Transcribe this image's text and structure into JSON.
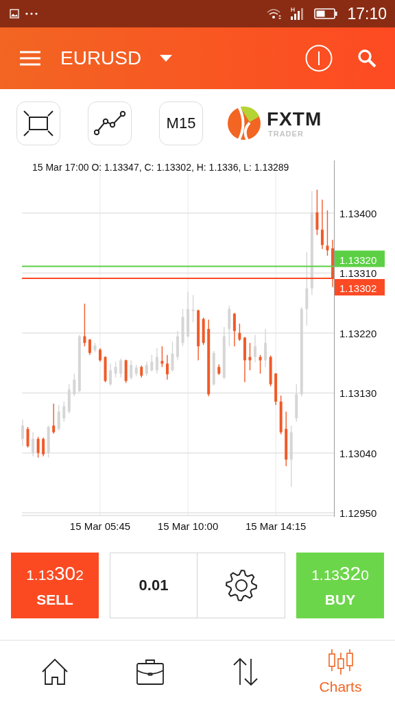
{
  "status_bar": {
    "time": "17:10"
  },
  "header": {
    "symbol": "EURUSD"
  },
  "toolbar": {
    "timeframe": "M15",
    "logo": {
      "name": "FXTM",
      "sub": "TRADER"
    }
  },
  "chart": {
    "caption": "15 Mar 17:00 O: 1.13347, C: 1.13302, H: 1.1336, L: 1.13289",
    "chart_data": {
      "type": "candlestick",
      "grid": true,
      "ref_lines": [
        {
          "axis": "y",
          "value": 1.1332,
          "color": "#5cd045",
          "label": "1.13320"
        },
        {
          "axis": "y",
          "value": 1.13302,
          "color": "#fb4a24",
          "label": "1.13302"
        }
      ],
      "categories": [
        null,
        null,
        null,
        null,
        null,
        null,
        null,
        null,
        null,
        null,
        null,
        null,
        null,
        null,
        null,
        "15 Mar 05:45",
        null,
        null,
        null,
        null,
        null,
        null,
        null,
        null,
        null,
        null,
        null,
        null,
        null,
        null,
        null,
        null,
        "15 Mar 10:00",
        null,
        null,
        null,
        null,
        null,
        null,
        null,
        null,
        null,
        null,
        null,
        null,
        null,
        null,
        null,
        null,
        "15 Mar 14:15",
        null,
        null,
        null,
        null,
        null,
        null,
        null,
        null,
        null,
        null,
        null
      ],
      "ohlc": [
        [
          1.13061,
          1.1309,
          1.1305,
          1.13081
        ],
        [
          1.13076,
          1.13079,
          1.13048,
          1.1305
        ],
        [
          1.1304,
          1.13071,
          1.13035,
          1.13061
        ],
        [
          1.13061,
          1.13064,
          1.13033,
          1.1304
        ],
        [
          1.13061,
          1.13063,
          1.13035,
          1.13038
        ],
        [
          1.1304,
          1.13081,
          1.13033,
          1.13079
        ],
        [
          1.13081,
          1.13114,
          1.13069,
          1.13071
        ],
        [
          1.13076,
          1.13112,
          1.13073,
          1.13102
        ],
        [
          1.13092,
          1.13117,
          1.13087,
          1.1311
        ],
        [
          1.13102,
          1.13143,
          1.13099,
          1.13135
        ],
        [
          1.13128,
          1.13159,
          1.13125,
          1.1315
        ],
        [
          1.13133,
          1.13217,
          1.13131,
          1.13215
        ],
        [
          1.13215,
          1.13264,
          1.132,
          1.13205
        ],
        [
          1.1321,
          1.13211,
          1.13187,
          1.1319
        ],
        [
          1.13194,
          1.13205,
          1.13191,
          1.13201
        ],
        [
          1.13195,
          1.13197,
          1.13177,
          1.13179
        ],
        [
          1.13184,
          1.13185,
          1.13146,
          1.13148
        ],
        [
          1.13143,
          1.13174,
          1.13141,
          1.13164
        ],
        [
          1.13159,
          1.13177,
          1.13153,
          1.13169
        ],
        [
          1.13159,
          1.13182,
          1.13153,
          1.13179
        ],
        [
          1.13179,
          1.1318,
          1.13145,
          1.13148
        ],
        [
          1.13153,
          1.13179,
          1.1315,
          1.13172
        ],
        [
          1.13159,
          1.13172,
          1.13155,
          1.13168
        ],
        [
          1.13169,
          1.13171,
          1.13153,
          1.13156
        ],
        [
          1.13159,
          1.13177,
          1.13155,
          1.13172
        ],
        [
          1.13164,
          1.13187,
          1.13162,
          1.13177
        ],
        [
          1.13164,
          1.13197,
          1.13159,
          1.13184
        ],
        [
          1.13178,
          1.132,
          1.13169,
          1.13174
        ],
        [
          1.13174,
          1.13187,
          1.1315,
          1.13158
        ],
        [
          1.13164,
          1.13207,
          1.13162,
          1.13189
        ],
        [
          1.13184,
          1.13223,
          1.13179,
          1.13215
        ],
        [
          1.13205,
          1.13256,
          1.132,
          1.13244
        ],
        [
          1.13215,
          1.13282,
          1.13213,
          1.13256
        ],
        [
          1.13253,
          1.13277,
          1.13236,
          1.13255
        ],
        [
          1.13254,
          1.13255,
          1.13179,
          1.132
        ],
        [
          1.13241,
          1.13243,
          1.13202,
          1.13205
        ],
        [
          1.13226,
          1.1324,
          1.13125,
          1.13128
        ],
        [
          1.13143,
          1.13193,
          1.13141,
          1.1319
        ],
        [
          1.13169,
          1.13173,
          1.13157,
          1.13159
        ],
        [
          1.13153,
          1.13229,
          1.13151,
          1.13215
        ],
        [
          1.13226,
          1.13261,
          1.132,
          1.13256
        ],
        [
          1.13249,
          1.1325,
          1.132,
          1.13223
        ],
        [
          1.1322,
          1.13234,
          1.13208,
          1.1321
        ],
        [
          1.13213,
          1.13214,
          1.13146,
          1.13179
        ],
        [
          1.13184,
          1.13205,
          1.13164,
          1.13179
        ],
        [
          1.13184,
          1.13217,
          1.13176,
          1.132
        ],
        [
          1.13184,
          1.13187,
          1.13159,
          1.13179
        ],
        [
          1.13179,
          1.13226,
          1.13169,
          1.13205
        ],
        [
          1.13184,
          1.13186,
          1.1314,
          1.13143
        ],
        [
          1.13159,
          1.1316,
          1.13112,
          1.13117
        ],
        [
          1.13117,
          1.13126,
          1.13068,
          1.13071
        ],
        [
          1.13076,
          1.13102,
          1.1302,
          1.1303
        ],
        [
          1.1303,
          1.13081,
          1.12989,
          1.13071
        ],
        [
          1.13092,
          1.13143,
          1.13087,
          1.13128
        ],
        [
          1.13128,
          1.13259,
          1.13125,
          1.13256
        ],
        [
          1.13256,
          1.13341,
          1.13231,
          1.13287
        ],
        [
          1.13287,
          1.13433,
          1.13277,
          1.13401
        ],
        [
          1.13401,
          1.13435,
          1.13367,
          1.13375
        ],
        [
          1.13375,
          1.1342,
          1.13346,
          1.13352
        ],
        [
          1.13351,
          1.13404,
          1.13336,
          1.13344
        ],
        [
          1.13347,
          1.1336,
          1.13289,
          1.13302
        ]
      ],
      "ylim": [
        1.12946,
        1.1348
      ],
      "yticks": [
        {
          "value": 1.134,
          "label": "1.13400"
        },
        {
          "value": 1.1331,
          "label": "1.13310"
        },
        {
          "value": 1.1322,
          "label": "1.13220"
        },
        {
          "value": 1.1313,
          "label": "1.13130"
        },
        {
          "value": 1.1304,
          "label": "1.13040"
        },
        {
          "value": 1.1295,
          "label": "1.12950"
        }
      ]
    }
  },
  "trade": {
    "sell": {
      "big": "1.13",
      "pips": "30",
      "last": "2",
      "label": "SELL"
    },
    "lot": "0.01",
    "buy": {
      "big": "1.13",
      "pips": "32",
      "last": "0",
      "label": "BUY"
    }
  },
  "nav": [
    {
      "kind": "home",
      "selected": false
    },
    {
      "kind": "portfolio",
      "selected": false
    },
    {
      "kind": "trades",
      "selected": false
    },
    {
      "kind": "charts",
      "label": "Charts",
      "selected": true
    }
  ]
}
